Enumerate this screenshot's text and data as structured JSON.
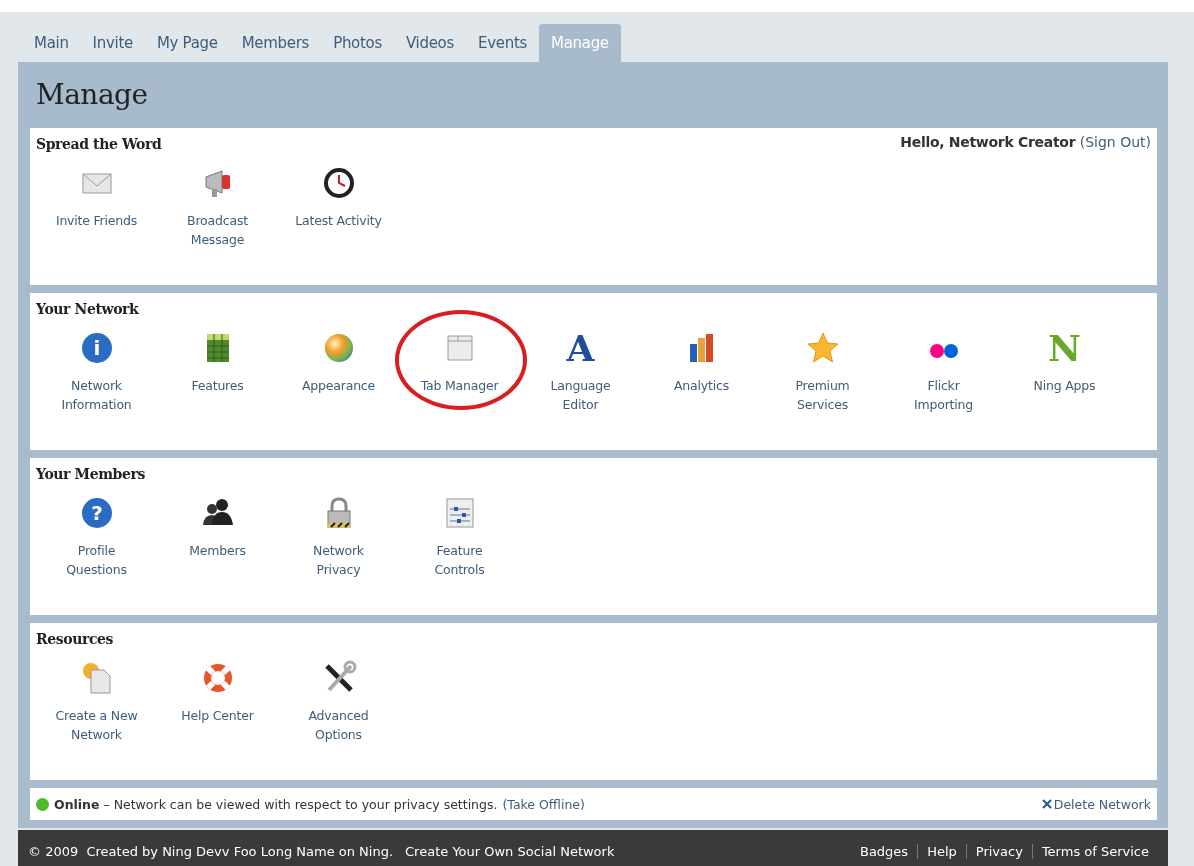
{
  "tabs": [
    {
      "label": "Main",
      "selected": false
    },
    {
      "label": "Invite",
      "selected": false
    },
    {
      "label": "My Page",
      "selected": false
    },
    {
      "label": "Members",
      "selected": false
    },
    {
      "label": "Photos",
      "selected": false
    },
    {
      "label": "Videos",
      "selected": false
    },
    {
      "label": "Events",
      "selected": false
    },
    {
      "label": "Manage",
      "selected": true
    }
  ],
  "page_title": "Manage",
  "greeting": {
    "text": "Hello, Network Creator",
    "link": "(Sign Out)"
  },
  "sections": [
    {
      "title": "Spread the Word",
      "items": [
        {
          "kind": "envelope",
          "label": "Invite Friends",
          "highlighted": false
        },
        {
          "kind": "megaphone",
          "label": "Broadcast\nMessage",
          "highlighted": false
        },
        {
          "kind": "clock",
          "label": "Latest Activity",
          "highlighted": false
        }
      ]
    },
    {
      "title": "Your Network",
      "items": [
        {
          "kind": "info",
          "glyph": "i",
          "label": "Network\nInformation",
          "highlighted": false
        },
        {
          "kind": "grid",
          "label": "Features",
          "highlighted": false
        },
        {
          "kind": "sphere",
          "label": "Appearance",
          "highlighted": false
        },
        {
          "kind": "window",
          "label": "Tab Manager",
          "highlighted": true
        },
        {
          "kind": "letter",
          "glyph": "A",
          "label": "Language\nEditor",
          "highlighted": false
        },
        {
          "kind": "bars",
          "label": "Analytics",
          "highlighted": false
        },
        {
          "kind": "star",
          "label": "Premium\nServices",
          "highlighted": false
        },
        {
          "kind": "dots",
          "label": "Flickr\nImporting",
          "highlighted": false
        },
        {
          "kind": "logo",
          "glyph": "N",
          "label": "Ning Apps",
          "highlighted": false
        }
      ]
    },
    {
      "title": "Your Members",
      "items": [
        {
          "kind": "question",
          "glyph": "?",
          "label": "Profile\nQuestions",
          "highlighted": false
        },
        {
          "kind": "people",
          "label": "Members",
          "highlighted": false
        },
        {
          "kind": "lock",
          "label": "Network\nPrivacy",
          "highlighted": false
        },
        {
          "kind": "sliders",
          "label": "Feature\nControls",
          "highlighted": false
        }
      ]
    },
    {
      "title": "Resources",
      "items": [
        {
          "kind": "document",
          "label": "Create a New\nNetwork",
          "highlighted": false
        },
        {
          "kind": "lifebuoy",
          "label": "Help Center",
          "highlighted": false
        },
        {
          "kind": "tools",
          "label": "Advanced\nOptions",
          "highlighted": false
        }
      ]
    }
  ],
  "status": {
    "online": true,
    "text": "**Online** – Network can be viewed with respect to your privacy settings.",
    "link": "(Take Offline)",
    "delete": "Delete Network"
  },
  "footer": {
    "text": "© 2009  Created by Ning Devv Foo Long Name on Ning.",
    "link": "Create Your Own Social Network",
    "links": [
      "Badges",
      "Help",
      "Privacy",
      "Terms of Service"
    ]
  }
}
